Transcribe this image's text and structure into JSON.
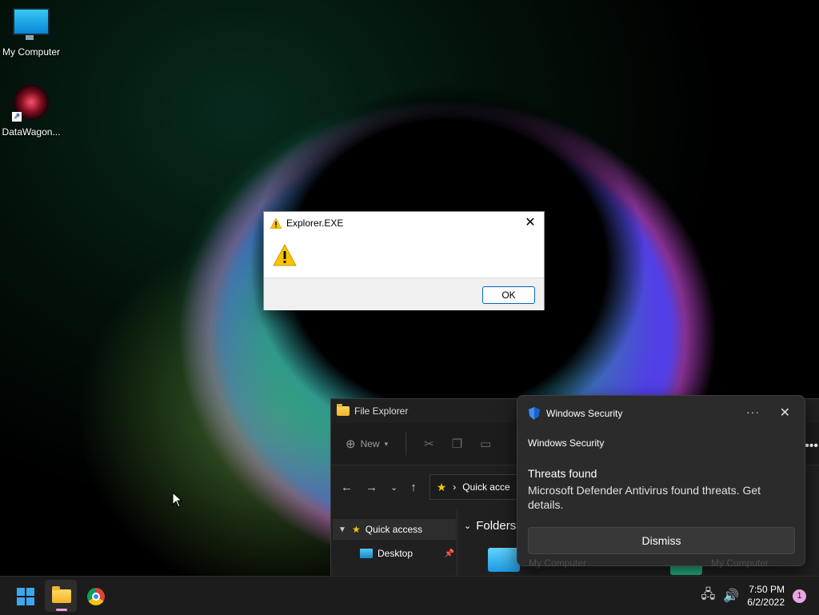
{
  "desktop": {
    "icons": [
      {
        "label": "My Computer"
      },
      {
        "label": "DataWagon..."
      }
    ]
  },
  "message_box": {
    "title": "Explorer.EXE",
    "ok_label": "OK",
    "icon": "warning-icon"
  },
  "explorer": {
    "title": "File Explorer",
    "toolbar": {
      "new_label": "New"
    },
    "address": "Quick acce",
    "sidebar": {
      "quick_access": "Quick access",
      "desktop": "Desktop"
    },
    "section": "Folders",
    "ghost_items": [
      "My Computer",
      "My Computer"
    ]
  },
  "toast": {
    "app_header": "Windows Security",
    "app_name": "Windows Security",
    "headline": "Threats found",
    "message": "Microsoft Defender Antivirus found threats. Get details.",
    "dismiss_label": "Dismiss"
  },
  "taskbar": {
    "time": "7:50 PM",
    "date": "6/2/2022",
    "notification_count": "1",
    "apps": [
      "start-button",
      "file-explorer",
      "chrome"
    ]
  },
  "colors": {
    "accent": "#0067c0",
    "taskbar": "#1c1c1c",
    "toast_bg": "#2b2b2b",
    "warning": "#f8c300"
  }
}
